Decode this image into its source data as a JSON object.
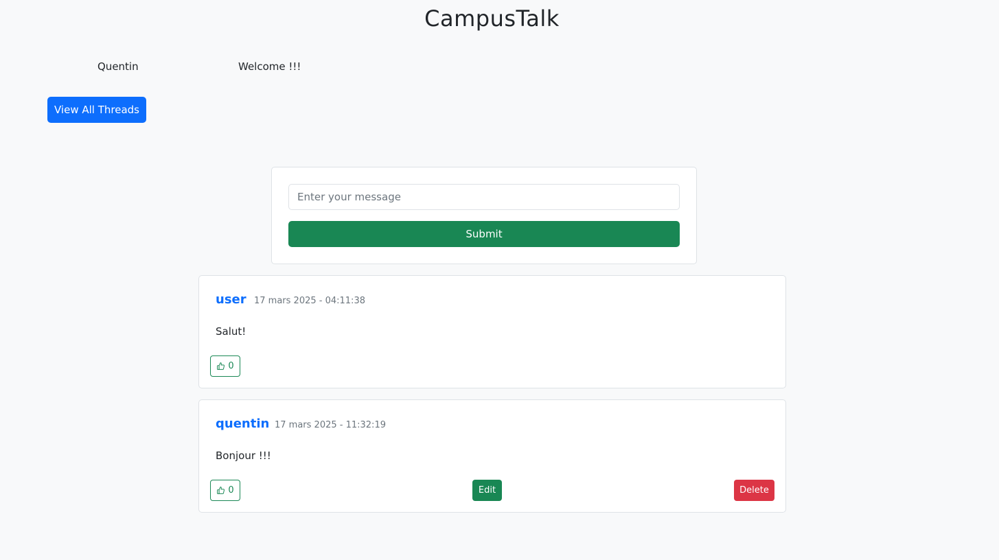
{
  "header": {
    "title": "CampusTalk",
    "user_name": "Quentin",
    "welcome": "Welcome !!!",
    "view_threads_label": "View All Threads"
  },
  "compose": {
    "placeholder": "Enter your message",
    "value": "",
    "submit_label": "Submit"
  },
  "posts": [
    {
      "author": "user",
      "date": "17 mars 2025 - 04:11:38",
      "text": "Salut!",
      "likes": "0"
    },
    {
      "author": "quentin",
      "date": "17 mars 2025 - 11:32:19",
      "text": "Bonjour !!!",
      "likes": "0",
      "edit_label": "Edit",
      "delete_label": "Delete"
    }
  ],
  "icons": {
    "like": "thumbs-up-icon"
  },
  "colors": {
    "primary": "#0d6efd",
    "success": "#198754",
    "danger": "#dc3545",
    "background": "#f8f9fa"
  }
}
